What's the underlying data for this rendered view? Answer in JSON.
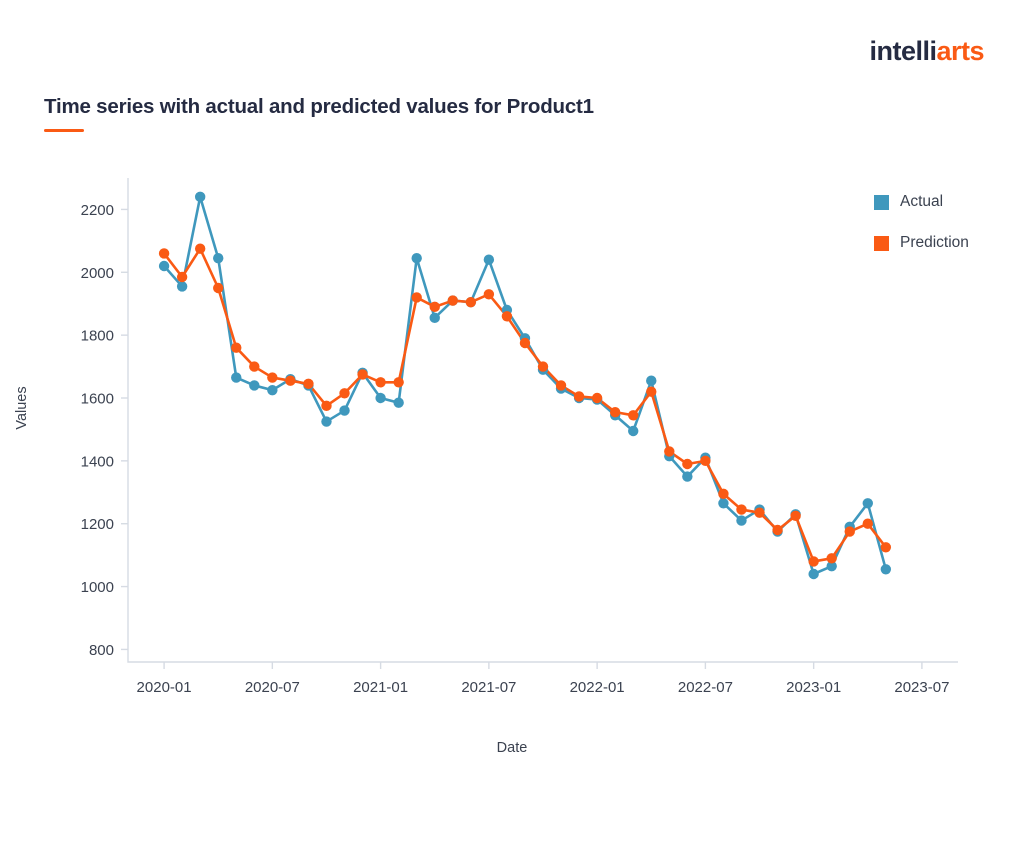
{
  "brand": {
    "name_part1": "intelli",
    "name_part2": "arts",
    "dark_color": "#252b42",
    "accent_color": "#fa5a14"
  },
  "header": {
    "title": "Time series with actual and predicted values for Product1"
  },
  "legend": {
    "position": "top-right",
    "items": [
      {
        "label": "Actual",
        "color": "#3f98bd",
        "marker": "square"
      },
      {
        "label": "Prediction",
        "color": "#fa5a14",
        "marker": "square"
      }
    ]
  },
  "chart_data": {
    "type": "line",
    "title": "Time series with actual and predicted values for Product1",
    "xlabel": "Date",
    "ylabel": "Values",
    "grid": false,
    "legend_position": "right",
    "xlim": [
      "2019-11",
      "2023-09"
    ],
    "ylim": [
      760,
      2300
    ],
    "yticks": [
      800,
      1000,
      1200,
      1400,
      1600,
      1800,
      2000,
      2200
    ],
    "xticks": [
      "2020-01",
      "2020-07",
      "2021-01",
      "2021-07",
      "2022-01",
      "2022-07",
      "2023-01",
      "2023-07"
    ],
    "x": [
      "2020-01",
      "2020-02",
      "2020-03",
      "2020-04",
      "2020-05",
      "2020-06",
      "2020-07",
      "2020-08",
      "2020-09",
      "2020-10",
      "2020-11",
      "2020-12",
      "2021-01",
      "2021-02",
      "2021-03",
      "2021-04",
      "2021-05",
      "2021-06",
      "2021-07",
      "2021-08",
      "2021-09",
      "2021-10",
      "2021-11",
      "2021-12",
      "2022-01",
      "2022-02",
      "2022-03",
      "2022-04",
      "2022-05",
      "2022-06",
      "2022-07",
      "2022-08",
      "2022-09",
      "2022-10",
      "2022-11",
      "2022-12",
      "2023-01",
      "2023-02",
      "2023-03",
      "2023-04",
      "2023-05"
    ],
    "series": [
      {
        "name": "Actual",
        "color": "#3f98bd",
        "values": [
          2020,
          1955,
          2240,
          2045,
          1665,
          1640,
          1625,
          1660,
          1640,
          1525,
          1560,
          1680,
          1600,
          1585,
          2045,
          1855,
          1910,
          1905,
          2040,
          1880,
          1790,
          1690,
          1630,
          1600,
          1595,
          1545,
          1495,
          1655,
          1415,
          1350,
          1410,
          1265,
          1210,
          1245,
          1175,
          1230,
          1040,
          1065,
          1190,
          1265,
          1055
        ]
      },
      {
        "name": "Prediction",
        "color": "#fa5a14",
        "values": [
          2060,
          1985,
          2075,
          1950,
          1760,
          1700,
          1665,
          1655,
          1645,
          1575,
          1615,
          1675,
          1650,
          1650,
          1920,
          1890,
          1910,
          1905,
          1930,
          1860,
          1775,
          1700,
          1640,
          1605,
          1600,
          1555,
          1545,
          1620,
          1430,
          1390,
          1400,
          1295,
          1245,
          1235,
          1180,
          1225,
          1080,
          1090,
          1175,
          1200,
          1125
        ]
      }
    ]
  }
}
